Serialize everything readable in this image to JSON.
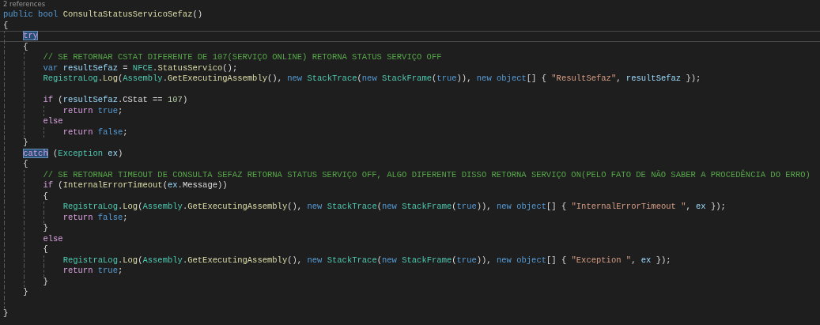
{
  "codelens": "2 references",
  "lines": [
    {
      "kind": "code",
      "tokens": [
        {
          "kind": "kw",
          "text": "public bool "
        },
        {
          "kind": "fn",
          "text": "ConsultaStatusServicoSefaz"
        },
        {
          "kind": "txt",
          "text": "()"
        }
      ]
    },
    {
      "kind": "code",
      "tokens": [
        {
          "kind": "txt",
          "text": "{"
        }
      ]
    },
    {
      "kind": "code",
      "current": true,
      "tokens": [
        {
          "kind": "ctl",
          "text": "    try",
          "highlighted": true
        }
      ]
    },
    {
      "kind": "code",
      "tokens": [
        {
          "kind": "txt",
          "text": "    {"
        }
      ]
    },
    {
      "kind": "code",
      "tokens": [
        {
          "kind": "cmt",
          "text": "        // SE RETORNAR CSTAT DIFERENTE DE 107(SERVIÇO ONLINE) RETORNA STATUS SERVIÇO OFF"
        }
      ]
    },
    {
      "kind": "code",
      "tokens": [
        {
          "kind": "kw",
          "text": "        var "
        },
        {
          "kind": "var",
          "text": "resultSefaz"
        },
        {
          "kind": "txt",
          "text": " = "
        },
        {
          "kind": "type",
          "text": "NFCE"
        },
        {
          "kind": "txt",
          "text": "."
        },
        {
          "kind": "fn",
          "text": "StatusServico"
        },
        {
          "kind": "txt",
          "text": "();"
        }
      ]
    },
    {
      "kind": "code",
      "tokens": [
        {
          "kind": "type",
          "text": "        RegistraLog"
        },
        {
          "kind": "txt",
          "text": "."
        },
        {
          "kind": "fn",
          "text": "Log"
        },
        {
          "kind": "txt",
          "text": "("
        },
        {
          "kind": "type",
          "text": "Assembly"
        },
        {
          "kind": "txt",
          "text": "."
        },
        {
          "kind": "fn",
          "text": "GetExecutingAssembly"
        },
        {
          "kind": "txt",
          "text": "(), "
        },
        {
          "kind": "kw",
          "text": "new "
        },
        {
          "kind": "type",
          "text": "StackTrace"
        },
        {
          "kind": "txt",
          "text": "("
        },
        {
          "kind": "kw",
          "text": "new "
        },
        {
          "kind": "type",
          "text": "StackFrame"
        },
        {
          "kind": "txt",
          "text": "("
        },
        {
          "kind": "kw",
          "text": "true"
        },
        {
          "kind": "txt",
          "text": ")), "
        },
        {
          "kind": "kw",
          "text": "new object"
        },
        {
          "kind": "txt",
          "text": "[] { "
        },
        {
          "kind": "str",
          "text": "\"ResultSefaz\""
        },
        {
          "kind": "txt",
          "text": ", "
        },
        {
          "kind": "var",
          "text": "resultSefaz"
        },
        {
          "kind": "txt",
          "text": " });"
        }
      ]
    },
    {
      "kind": "blank"
    },
    {
      "kind": "code",
      "tokens": [
        {
          "kind": "ctl",
          "text": "        if"
        },
        {
          "kind": "txt",
          "text": " ("
        },
        {
          "kind": "var",
          "text": "resultSefaz"
        },
        {
          "kind": "txt",
          "text": ".CStat == "
        },
        {
          "kind": "num",
          "text": "107"
        },
        {
          "kind": "txt",
          "text": ")"
        }
      ]
    },
    {
      "kind": "code",
      "tokens": [
        {
          "kind": "ctl",
          "text": "            return "
        },
        {
          "kind": "kw",
          "text": "true"
        },
        {
          "kind": "txt",
          "text": ";"
        }
      ]
    },
    {
      "kind": "code",
      "tokens": [
        {
          "kind": "ctl",
          "text": "        else"
        }
      ]
    },
    {
      "kind": "code",
      "tokens": [
        {
          "kind": "ctl",
          "text": "            return "
        },
        {
          "kind": "kw",
          "text": "false"
        },
        {
          "kind": "txt",
          "text": ";"
        }
      ]
    },
    {
      "kind": "code",
      "tokens": [
        {
          "kind": "txt",
          "text": "    }"
        }
      ]
    },
    {
      "kind": "code",
      "tokens": [
        {
          "kind": "ctl",
          "text": "    catch",
          "highlighted": true
        },
        {
          "kind": "txt",
          "text": " ("
        },
        {
          "kind": "type",
          "text": "Exception"
        },
        {
          "kind": "var",
          "text": " ex"
        },
        {
          "kind": "txt",
          "text": ")"
        }
      ]
    },
    {
      "kind": "code",
      "tokens": [
        {
          "kind": "txt",
          "text": "    {"
        }
      ]
    },
    {
      "kind": "code",
      "tokens": [
        {
          "kind": "cmt",
          "text": "        // SE RETORNAR TIMEOUT DE CONSULTA SEFAZ RETORNA STATUS SERVIÇO OFF, ALGO DIFERENTE DISSO RETORNA SERVIÇO ON(PELO FATO DE NÃO SABER A PROCEDÊNCIA DO ERRO)"
        }
      ]
    },
    {
      "kind": "code",
      "tokens": [
        {
          "kind": "ctl",
          "text": "        if"
        },
        {
          "kind": "txt",
          "text": " ("
        },
        {
          "kind": "fn",
          "text": "InternalErrorTimeout"
        },
        {
          "kind": "txt",
          "text": "("
        },
        {
          "kind": "var",
          "text": "ex"
        },
        {
          "kind": "txt",
          "text": ".Message))"
        }
      ]
    },
    {
      "kind": "code",
      "tokens": [
        {
          "kind": "txt",
          "text": "        {"
        }
      ]
    },
    {
      "kind": "code",
      "tokens": [
        {
          "kind": "type",
          "text": "            RegistraLog"
        },
        {
          "kind": "txt",
          "text": "."
        },
        {
          "kind": "fn",
          "text": "Log"
        },
        {
          "kind": "txt",
          "text": "("
        },
        {
          "kind": "type",
          "text": "Assembly"
        },
        {
          "kind": "txt",
          "text": "."
        },
        {
          "kind": "fn",
          "text": "GetExecutingAssembly"
        },
        {
          "kind": "txt",
          "text": "(), "
        },
        {
          "kind": "kw",
          "text": "new "
        },
        {
          "kind": "type",
          "text": "StackTrace"
        },
        {
          "kind": "txt",
          "text": "("
        },
        {
          "kind": "kw",
          "text": "new "
        },
        {
          "kind": "type",
          "text": "StackFrame"
        },
        {
          "kind": "txt",
          "text": "("
        },
        {
          "kind": "kw",
          "text": "true"
        },
        {
          "kind": "txt",
          "text": ")), "
        },
        {
          "kind": "kw",
          "text": "new object"
        },
        {
          "kind": "txt",
          "text": "[] { "
        },
        {
          "kind": "str",
          "text": "\"InternalErrorTimeout \""
        },
        {
          "kind": "txt",
          "text": ", "
        },
        {
          "kind": "var",
          "text": "ex"
        },
        {
          "kind": "txt",
          "text": " });"
        }
      ]
    },
    {
      "kind": "code",
      "tokens": [
        {
          "kind": "ctl",
          "text": "            return "
        },
        {
          "kind": "kw",
          "text": "false"
        },
        {
          "kind": "txt",
          "text": ";"
        }
      ]
    },
    {
      "kind": "code",
      "tokens": [
        {
          "kind": "txt",
          "text": "        }"
        }
      ]
    },
    {
      "kind": "code",
      "tokens": [
        {
          "kind": "ctl",
          "text": "        else"
        }
      ]
    },
    {
      "kind": "code",
      "tokens": [
        {
          "kind": "txt",
          "text": "        {"
        }
      ]
    },
    {
      "kind": "code",
      "tokens": [
        {
          "kind": "type",
          "text": "            RegistraLog"
        },
        {
          "kind": "txt",
          "text": "."
        },
        {
          "kind": "fn",
          "text": "Log"
        },
        {
          "kind": "txt",
          "text": "("
        },
        {
          "kind": "type",
          "text": "Assembly"
        },
        {
          "kind": "txt",
          "text": "."
        },
        {
          "kind": "fn",
          "text": "GetExecutingAssembly"
        },
        {
          "kind": "txt",
          "text": "(), "
        },
        {
          "kind": "kw",
          "text": "new "
        },
        {
          "kind": "type",
          "text": "StackTrace"
        },
        {
          "kind": "txt",
          "text": "("
        },
        {
          "kind": "kw",
          "text": "new "
        },
        {
          "kind": "type",
          "text": "StackFrame"
        },
        {
          "kind": "txt",
          "text": "("
        },
        {
          "kind": "kw",
          "text": "true"
        },
        {
          "kind": "txt",
          "text": ")), "
        },
        {
          "kind": "kw",
          "text": "new object"
        },
        {
          "kind": "txt",
          "text": "[] { "
        },
        {
          "kind": "str",
          "text": "\"Exception \""
        },
        {
          "kind": "txt",
          "text": ", "
        },
        {
          "kind": "var",
          "text": "ex"
        },
        {
          "kind": "txt",
          "text": " });"
        }
      ]
    },
    {
      "kind": "code",
      "tokens": [
        {
          "kind": "ctl",
          "text": "            return "
        },
        {
          "kind": "kw",
          "text": "true"
        },
        {
          "kind": "txt",
          "text": ";"
        }
      ]
    },
    {
      "kind": "code",
      "tokens": [
        {
          "kind": "txt",
          "text": "        }"
        }
      ]
    },
    {
      "kind": "code",
      "tokens": [
        {
          "kind": "txt",
          "text": "    }"
        }
      ]
    },
    {
      "kind": "blank"
    },
    {
      "kind": "code",
      "tokens": [
        {
          "kind": "txt",
          "text": "}"
        }
      ]
    }
  ]
}
